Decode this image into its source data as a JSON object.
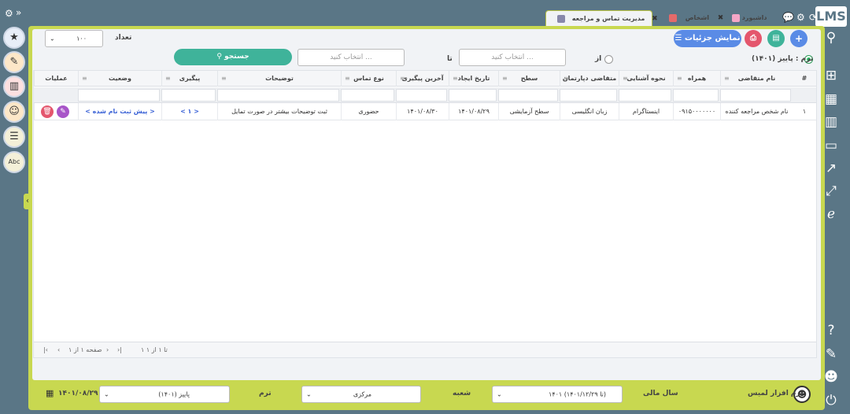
{
  "sidebar_right": {
    "logo": "LMS",
    "icons": [
      "search-icon",
      "org-chart-icon",
      "grid-icon",
      "bar-chart-icon",
      "card-icon",
      "trend-icon",
      "expand-icon",
      "ie-icon",
      "help-icon",
      "brush-icon",
      "user-icon",
      "power-icon"
    ]
  },
  "tabs": [
    {
      "label": "داشبورد"
    },
    {
      "label": "اشخاص"
    },
    {
      "label": "مدیریت تماس و مراجعه"
    }
  ],
  "toolbar": {
    "details_label": "نمایش جزئیات",
    "term_label": "ترم : پاییز (۱۴۰۱)",
    "from_label": "از",
    "to_label": "تا",
    "date_placeholder": "انتخاب کنید ...",
    "search_label": "جستجو",
    "count_label": "تعداد",
    "count_value": "۱۰۰"
  },
  "table": {
    "columns": [
      "#",
      "نام متقاضی",
      "همراه",
      "نحوه آشنایی",
      "متقاضی دپارتمان",
      "سطح",
      "تاریخ ایجاد",
      "آخرین پیگیری",
      "نوع تماس",
      "توضیحات",
      "پیگیری",
      "وضعیت",
      "عملیات"
    ],
    "rows": [
      [
        "۱",
        "نام شخص مراجعه کننده",
        "۰۹۱۵۰۰۰۰۰۰۰",
        "اینستاگرام",
        "زبان انگلیسی",
        "سطح آزمایشی",
        "۱۴۰۱/۰۸/۲۹",
        "۱۴۰۱/۰۸/۳۰",
        "حضوری",
        "ثبت توضیحات بیشتر در صورت تمایل",
        "< ۱ >",
        "< پیش ثبت نام شده >",
        ""
      ]
    ],
    "footer": {
      "range": "۱ تا ۱ از ۱",
      "page": "صفحه ۱ از ۱"
    }
  },
  "bottom": {
    "app_name": "نرم افزار لمیس",
    "fiscal_label": "سال مالی",
    "fiscal_value": "۱۴۰۱ (تا ۱۴۰۱/۱۲/۲۹)",
    "branch_label": "شعبه",
    "branch_value": "مرکزی",
    "term_label": "ترم",
    "term_value": "پاییز (۱۴۰۱)",
    "date": "۱۴۰۱/۰۸/۲۹"
  }
}
